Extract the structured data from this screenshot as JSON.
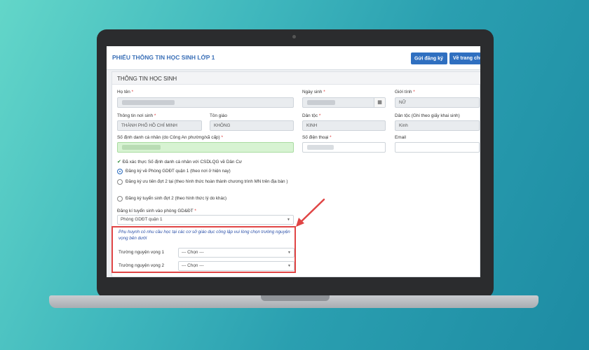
{
  "header": {
    "title": "PHIẾU THÔNG TIN HỌC SINH LỚP 1",
    "register_button": "Gửi đăng ký",
    "home_button": "Về trang chủ"
  },
  "section": {
    "title": "THÔNG TIN HỌC SINH"
  },
  "fields": {
    "fullname_label": "Họ tên",
    "dob_label": "Ngày sinh",
    "gender_label": "Giới tính",
    "gender_value": "NỮ",
    "birthplace_label": "Thông tin nơi sinh",
    "birthplace_value": "THÀNH PHỐ HỒ CHÍ MINH",
    "religion_label": "Tôn giáo",
    "religion_value": "KHÔNG",
    "ethnicity_label": "Dân tộc",
    "ethnicity_value": "KINH",
    "ethnicity_birth_label": "Dân tộc (Ghi theo giấy khai sinh)",
    "ethnicity_birth_value": "Kinh",
    "personal_id_label": "Số định danh cá nhân (do Công An phường/xã cấp)",
    "phone_label": "Số điện thoại",
    "email_label": "Email",
    "required_mark": "*"
  },
  "verification_text": "Đã xác thực Số định danh cá nhân với CSDLQG về Dân Cư",
  "radio_options": [
    {
      "label": "Đăng ký về Phòng GDĐT quận 1 (theo nơi ở hiện nay)",
      "selected": true
    },
    {
      "label": "Đăng ký ưu tiên đợt 2 tại (theo hình thức hoàn thành chương trình MN trên địa bàn )",
      "selected": false
    },
    {
      "label": "Đăng ký tuyển sinh đợt 2 (theo hình thức lý do khác)",
      "selected": false
    }
  ],
  "enroll_office": {
    "label": "Đăng kí tuyển sinh vào phòng GD&ĐT",
    "value": "Phòng GDĐT quận 1"
  },
  "public_school_note": "Phụ huynh có nhu cầu học tại các cơ sở giáo dục công lập vui lòng chọn trường nguyện vọng bên dưới",
  "wishes": [
    {
      "label": "Trường nguyện vọng 1",
      "value": "--- Chọn ---"
    },
    {
      "label": "Trường nguyện vọng 2",
      "value": "--- Chọn ---"
    }
  ],
  "icons": {
    "calendar": "calendar-icon",
    "check": "check-icon",
    "caret": "chevron-down-icon"
  },
  "colors": {
    "primary": "#2f6fc0",
    "highlight": "#e04545",
    "verified_field": "#d7f3d2"
  }
}
